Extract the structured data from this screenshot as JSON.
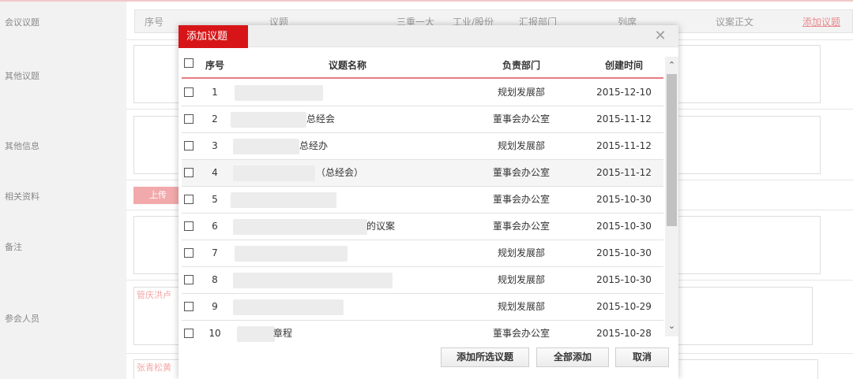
{
  "background": {
    "left_labels": [
      "会议议题",
      "其他议题",
      "其他信息",
      "相关资料",
      "备注",
      "参会人员"
    ],
    "table_header": [
      "序号",
      "议题",
      "三重一大",
      "工业/股份",
      "汇报部门",
      "列席",
      "议案正文"
    ],
    "header_link": "添加议题",
    "upload_label": "上传",
    "participants_text": "管庆洪卢",
    "participants_text2": "张青松黄"
  },
  "modal": {
    "title": "添加议题",
    "close_symbol": "✕",
    "columns": {
      "index": "序号",
      "name": "议题名称",
      "dept": "负责部门",
      "date": "创建时间"
    },
    "rows": [
      {
        "index": "1",
        "name_visible": "",
        "dept": "规划发展部",
        "date": "2015-12-10"
      },
      {
        "index": "2",
        "name_visible": "总经会",
        "dept": "董事会办公室",
        "date": "2015-11-12"
      },
      {
        "index": "3",
        "name_visible": "总经办",
        "dept": "规划发展部",
        "date": "2015-11-12"
      },
      {
        "index": "4",
        "name_visible": "（总经会）",
        "dept": "董事会办公室",
        "date": "2015-11-12"
      },
      {
        "index": "5",
        "name_visible": "",
        "dept": "董事会办公室",
        "date": "2015-10-30"
      },
      {
        "index": "6",
        "name_visible": "的议案",
        "dept": "董事会办公室",
        "date": "2015-10-30"
      },
      {
        "index": "7",
        "name_visible": "",
        "dept": "规划发展部",
        "date": "2015-10-30"
      },
      {
        "index": "8",
        "name_visible": "",
        "dept": "规划发展部",
        "date": "2015-10-30"
      },
      {
        "index": "9",
        "name_visible": "",
        "dept": "规划发展部",
        "date": "2015-10-29"
      },
      {
        "index": "10",
        "name_visible": "章程",
        "dept": "董事会办公室",
        "date": "2015-10-28"
      }
    ],
    "buttons": {
      "add_selected": "添加所选议题",
      "add_all": "全部添加",
      "cancel": "取消"
    }
  },
  "colors": {
    "accent_red": "#d71518",
    "divider_pink": "#e77c80",
    "link_pink": "#e9898e"
  }
}
